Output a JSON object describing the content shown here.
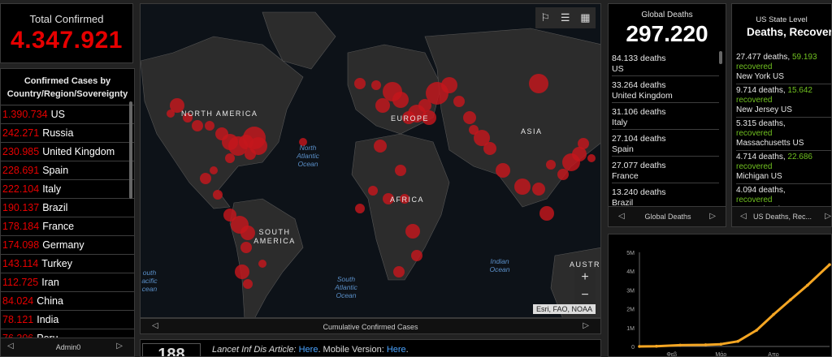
{
  "total": {
    "label": "Total Confirmed",
    "value": "4.347.921"
  },
  "countries": {
    "header": "Confirmed Cases by Country/Region/Sovereignty",
    "footer_label": "Admin0",
    "items": [
      {
        "value": "1.390.734",
        "name": "US"
      },
      {
        "value": "242.271",
        "name": "Russia"
      },
      {
        "value": "230.985",
        "name": "United Kingdom"
      },
      {
        "value": "228.691",
        "name": "Spain"
      },
      {
        "value": "222.104",
        "name": "Italy"
      },
      {
        "value": "190.137",
        "name": "Brazil"
      },
      {
        "value": "178.184",
        "name": "France"
      },
      {
        "value": "174.098",
        "name": "Germany"
      },
      {
        "value": "143.114",
        "name": "Turkey"
      },
      {
        "value": "112.725",
        "name": "Iran"
      },
      {
        "value": "84.024",
        "name": "China"
      },
      {
        "value": "78.121",
        "name": "India"
      },
      {
        "value": "76.306",
        "name": "Peru"
      }
    ]
  },
  "map": {
    "footer_label": "Cumulative Confirmed Cases",
    "attribution": "Esri, FAO, NOAA",
    "zoom_in": "+",
    "zoom_out": "−",
    "labels": {
      "north_america": "NORTH AMERICA",
      "south_america": "SOUTH AMERICA",
      "europe": "EUROPE",
      "africa": "AFRICA",
      "asia": "ASIA",
      "australia": "AUSTR",
      "north_atlantic": "North Atlantic Ocean",
      "south_atlantic": "South Atlantic Ocean",
      "indian": "Indian Ocean",
      "south_pacific_left": "outh acific cean"
    }
  },
  "info": {
    "big_number": "188",
    "text_prefix": "Lancet Inf Dis Article: ",
    "link1": "Here",
    "text_mid": ". Mobile Version: ",
    "link2": "Here",
    "text_suffix": "."
  },
  "deaths": {
    "label": "Global Deaths",
    "value": "297.220",
    "footer_label": "Global Deaths",
    "items": [
      {
        "value": "84.133 deaths",
        "name": "US"
      },
      {
        "value": "33.264 deaths",
        "name": "United Kingdom"
      },
      {
        "value": "31.106 deaths",
        "name": "Italy"
      },
      {
        "value": "27.104 deaths",
        "name": "Spain"
      },
      {
        "value": "27.077 deaths",
        "name": "France"
      },
      {
        "value": "13.240 deaths",
        "name": "Brazil"
      }
    ]
  },
  "us_states": {
    "header": "US State Level",
    "title": "Deaths, Recovered",
    "footer_label": "US Deaths, Rec...",
    "items": [
      {
        "deaths": "27.477 deaths,",
        "recovered": "59.193",
        "rec_label": "recovered",
        "name": "New York US"
      },
      {
        "deaths": "9.714 deaths,",
        "recovered": "15.642",
        "rec_label": "recovered",
        "name": "New Jersey US"
      },
      {
        "deaths": "5.315 deaths,",
        "recovered": "",
        "rec_label": "recovered",
        "name": "Massachusetts US"
      },
      {
        "deaths": "4.714 deaths,",
        "recovered": "22.686",
        "rec_label": "recovered",
        "name": "Michigan US"
      },
      {
        "deaths": "4.094 deaths,",
        "recovered": "",
        "rec_label": "recovered",
        "name": "Pennsylvania US"
      }
    ]
  },
  "chart_data": {
    "type": "line",
    "title": "",
    "xlabel": "",
    "ylabel": "",
    "y_ticks": [
      "0",
      "1M",
      "2M",
      "3M",
      "4M",
      "5M"
    ],
    "x_ticks": [
      "Φεβ",
      "Μάρ",
      "Απρ"
    ],
    "ylim": [
      0,
      5000000
    ],
    "line_color": "#f5a623",
    "series": [
      {
        "x": [
          "2020-01-22",
          "2020-02-01",
          "2020-02-15",
          "2020-03-01",
          "2020-03-10",
          "2020-03-20",
          "2020-03-31",
          "2020-04-10",
          "2020-04-20",
          "2020-04-30",
          "2020-05-13"
        ],
        "values": [
          500,
          12000,
          69000,
          88000,
          120000,
          270000,
          860000,
          1700000,
          2480000,
          3250000,
          4347921
        ]
      }
    ]
  }
}
